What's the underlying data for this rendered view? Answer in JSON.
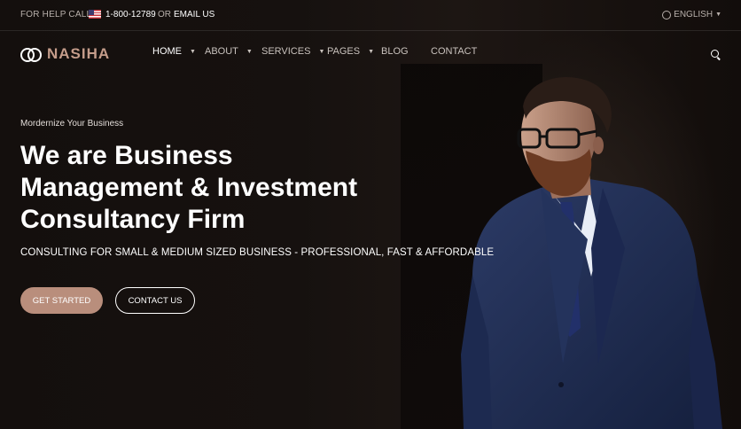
{
  "topbar": {
    "help_label": "FOR HELP CALL",
    "flag_icon": "us-flag-icon",
    "phone": "1-800-12789",
    "or_label": "OR",
    "email_label": "EMAIL US",
    "language": "ENGLISH"
  },
  "nav": {
    "brand": "NASIHA",
    "items": [
      {
        "label": "HOME",
        "dropdown": true,
        "active": true
      },
      {
        "label": "ABOUT",
        "dropdown": true
      },
      {
        "label": "SERVICES",
        "dropdown": true
      },
      {
        "label": "PAGES",
        "dropdown": true
      },
      {
        "label": "BLOG",
        "dropdown": false
      },
      {
        "label": "CONTACT",
        "dropdown": false
      }
    ],
    "search_icon": "search-icon"
  },
  "hero": {
    "eyebrow": "Mordernize Your Business",
    "headline_lines": [
      "We are Business",
      "Management & Investment",
      "Consultancy Firm"
    ],
    "subline": "CONSULTING FOR SMALL & MEDIUM SIZED BUSINESS - PROFESSIONAL, FAST & AFFORDABLE",
    "primary_button": "GET STARTED",
    "secondary_button": "CONTACT US"
  },
  "colors": {
    "accent": "#b98e7c",
    "brand_text": "#c49c8a",
    "background": "#140f0d"
  }
}
